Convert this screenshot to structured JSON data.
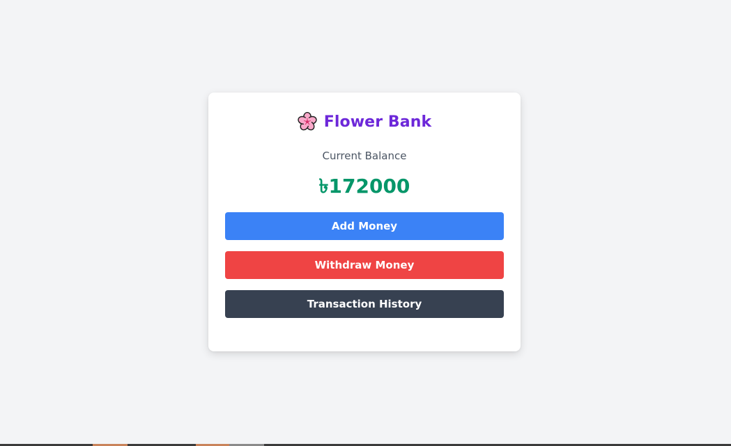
{
  "app": {
    "title": "Flower Bank",
    "logo_icon": "cherry-blossom-icon"
  },
  "balance": {
    "label": "Current Balance",
    "amount": "৳172000"
  },
  "actions": {
    "add_label": "Add Money",
    "withdraw_label": "Withdraw Money",
    "history_label": "Transaction History"
  },
  "colors": {
    "title": "#6d28d9",
    "balance": "#059669",
    "add": "#3b82f6",
    "withdraw": "#ef4444",
    "history": "#374151",
    "background": "#f3f4f6"
  }
}
